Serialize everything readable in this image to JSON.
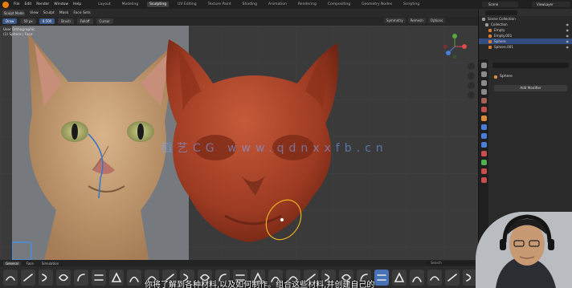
{
  "menubar": {
    "items": [
      "File",
      "Edit",
      "Render",
      "Window",
      "Help"
    ],
    "workspaces": [
      "Layout",
      "Modeling",
      "Sculpting",
      "UV Editing",
      "Texture Paint",
      "Shading",
      "Animation",
      "Rendering",
      "Compositing",
      "Geometry Nodes",
      "Scripting"
    ],
    "active_workspace": "Sculpting",
    "scene": "Scene",
    "view_layer": "ViewLayer"
  },
  "viewport_header": {
    "mode": "Sculpt Mode",
    "menus": [
      "View",
      "Sculpt",
      "Mask",
      "Face Sets"
    ]
  },
  "tool_header": {
    "brush": "Draw",
    "radius": "50 px",
    "strength": "0.500",
    "direction": "Brush",
    "falloff": "Falloff",
    "cursor": "Cursor"
  },
  "viewport_overlay": {
    "view_name": "User Orthographic",
    "object_info": "(1) Sphere | Face"
  },
  "viewport_topright": [
    "Symmetry",
    "Remesh",
    "Options"
  ],
  "watermark": "稻艺CG www.qdnxxfb.cn",
  "outliner": {
    "rows": [
      {
        "label": "Scene Collection",
        "type": "collection",
        "selected": false
      },
      {
        "label": "Collection",
        "type": "collection",
        "selected": false
      },
      {
        "label": "Empty",
        "type": "object",
        "selected": false
      },
      {
        "label": "Empty.001",
        "type": "object",
        "selected": false
      },
      {
        "label": "Sphere",
        "type": "object",
        "selected": true
      },
      {
        "label": "Sphere.001",
        "type": "object",
        "selected": false
      }
    ]
  },
  "properties": {
    "object_name": "Sphere",
    "add_modifier_label": "Add Modifier"
  },
  "shelf": {
    "tabs": [
      "General",
      "Face",
      "Simulation"
    ],
    "active_tab": "General",
    "search_placeholder": "Search",
    "brush_count": 28,
    "active_brush_index": 21
  },
  "subtitle": "你将了解到各种材料,以及如何制作。组合这些材料,并创建自己的",
  "colors": {
    "clay": "#b04a2e",
    "accent": "#4773b6",
    "brush_ring": "#f0b020"
  }
}
